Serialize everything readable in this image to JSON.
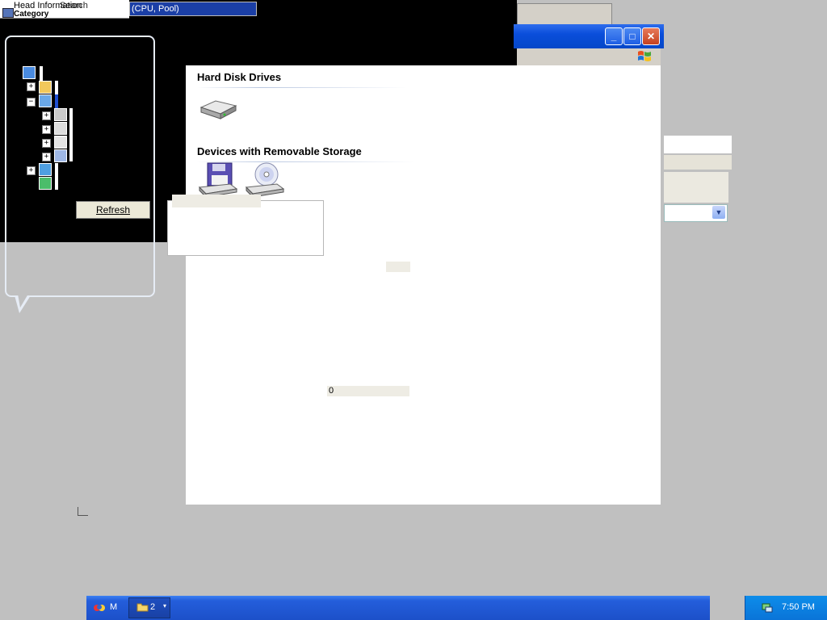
{
  "top": {
    "label_1": "Head Information",
    "label_2": "Search",
    "label_3": "Category",
    "combo_selected": "(CPU, Pool)"
  },
  "window": {
    "min_glyph": "_",
    "max_glyph": "□",
    "close_glyph": "✕"
  },
  "main": {
    "sections": [
      {
        "title": "Hard Disk Drives"
      },
      {
        "title": "Devices with Removable Storage"
      }
    ],
    "zero_value": "0"
  },
  "tree": {
    "refresh_label": "Refresh",
    "expanders": [
      "+",
      "−",
      "+",
      "+",
      "+",
      "+",
      "+"
    ]
  },
  "taskbar": {
    "item1_label": "M",
    "item2_label": "2",
    "item2_arrow": "▾",
    "clock": "7:50 PM"
  },
  "colors": {
    "taskbar_blue": "#245edb",
    "titlebar_blue": "#0a4edb",
    "tray_blue": "#0a74d8",
    "selection_blue": "#1b3fa6"
  },
  "icons": {
    "hard_disk": "hard-disk-drive-icon",
    "floppy": "floppy-drive-icon",
    "cd": "cd-drive-icon",
    "windows_flag": "windows-logo-icon",
    "tray": "network-tray-icon"
  }
}
